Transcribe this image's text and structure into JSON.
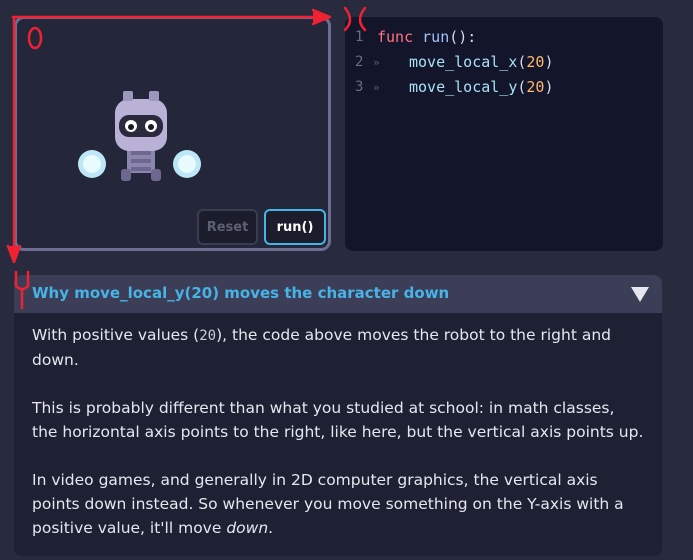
{
  "viewport": {
    "reset_label": "Reset",
    "run_label": "run()"
  },
  "code": {
    "lines": [
      {
        "num": "1",
        "tokens": {
          "kw": "func",
          "name": "run",
          "punct": "():"
        }
      },
      {
        "num": "2",
        "marker": "»",
        "call": "move_local_x",
        "open": "(",
        "arg": "20",
        "close": ")"
      },
      {
        "num": "3",
        "marker": "»",
        "call": "move_local_y",
        "open": "(",
        "arg": "20",
        "close": ")"
      }
    ]
  },
  "panel": {
    "title": "Why move_local_y(20) moves the character down",
    "para1_before": "With positive values (",
    "para1_code": "20",
    "para1_after": "), the code above moves the robot to the right and down.",
    "para2": "This is probably different than what you studied at school: in math classes, the horizontal axis points to the right, like here, but the vertical axis points up.",
    "para3_before": "In video games, and generally in 2D computer graphics, the vertical axis points down instead. So whenever you move something on the Y-axis with a positive value, it'll move ",
    "para3_em": "down",
    "para3_after": "."
  },
  "annotations": {
    "origin": "0",
    "x": "X",
    "y": "Y"
  },
  "colors": {
    "accent": "#47b3e6",
    "annotation_red": "#ee2233",
    "keyword": "#ff7085",
    "number": "#ffb86c"
  },
  "icons": {
    "toggle": "triangle-down-icon",
    "robot": "robot-sprite-icon"
  }
}
